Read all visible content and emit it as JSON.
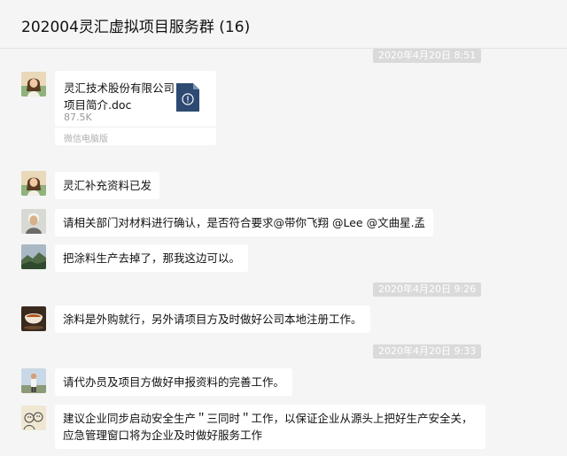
{
  "chat": {
    "title": "202004灵汇虚拟项目服务群 (16)"
  },
  "timestamps": [
    "2020年4月20日 8:51",
    "2020年4月20日 9:26",
    "2020年4月20日 9:33"
  ],
  "file": {
    "name": "灵汇技术股份有限公司 项目简介.doc",
    "size": "87.5K",
    "source": "微信电脑版",
    "icon": "doc-file-icon"
  },
  "messages": [
    {
      "avatar": "avatar-woman",
      "text": "灵汇补充资料已发"
    },
    {
      "avatar": "avatar-man-white-hair",
      "text": "请相关部门对材料进行确认，是否符合要求@带你飞翔 @Lee @文曲星.孟"
    },
    {
      "avatar": "avatar-landscape",
      "text": "把涂料生产去掉了，那我这边可以。"
    },
    {
      "avatar": "avatar-tea-cup",
      "text": "涂料是外购就行，另外请项目方及时做好公司本地注册工作。"
    },
    {
      "avatar": "avatar-person-outdoor",
      "text": "请代办员及项目方做好申报资料的完善工作。"
    },
    {
      "avatar": "avatar-cartoon",
      "text": "建议企业同步启动安全生产＂三同时＂工作，以保证企业从源头上把好生产安全关，应急管理窗口将为企业及时做好服务工作"
    }
  ],
  "colors": {
    "background": "#f5f5f5",
    "bubble": "#ffffff",
    "timestamp_pill": "#dadada"
  }
}
